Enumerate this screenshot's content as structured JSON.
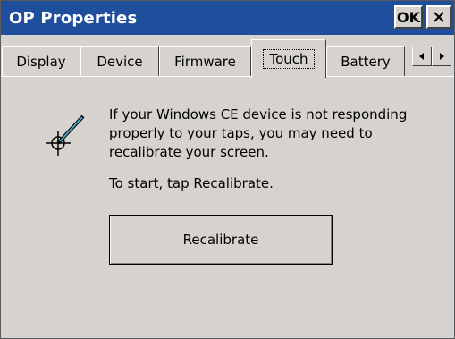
{
  "window": {
    "title": "OP Properties"
  },
  "titlebar": {
    "ok_label": "OK",
    "close_icon": "close-icon"
  },
  "tabs": [
    {
      "label": "Display",
      "active": false
    },
    {
      "label": "Device",
      "active": false
    },
    {
      "label": "Firmware",
      "active": false
    },
    {
      "label": "Touch",
      "active": true
    },
    {
      "label": "Battery",
      "active": false
    }
  ],
  "tab_scroll": {
    "left_icon": "arrow-left-icon",
    "right_icon": "arrow-right-icon"
  },
  "touch": {
    "description": "If your Windows CE device is not responding properly to your taps, you may need to recalibrate your screen.",
    "instruction": "To start, tap Recalibrate.",
    "button_label": "Recalibrate",
    "icon": "stylus-crosshair-icon"
  },
  "colors": {
    "titlebar": "#1f4e9c",
    "face": "#d6d3ce",
    "stylus": "#4aa3c8"
  }
}
